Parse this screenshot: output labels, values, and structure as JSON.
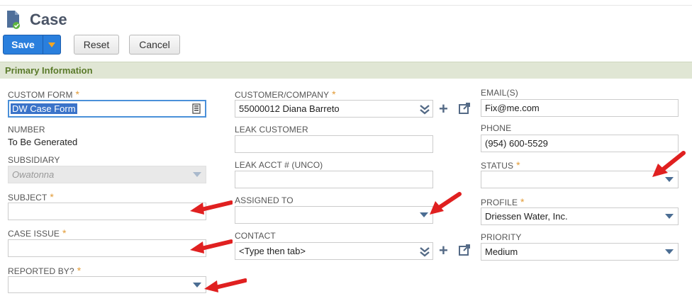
{
  "page": {
    "title": "Case"
  },
  "toolbar": {
    "save_label": "Save",
    "reset_label": "Reset",
    "cancel_label": "Cancel"
  },
  "section": {
    "title": "Primary Information"
  },
  "fields": {
    "custom_form": {
      "label": "CUSTOM FORM",
      "required": "*",
      "value": "DW Case Form"
    },
    "number": {
      "label": "NUMBER",
      "value": "To Be Generated"
    },
    "subsidiary": {
      "label": "SUBSIDIARY",
      "value": "Owatonna"
    },
    "subject": {
      "label": "SUBJECT",
      "required": "*",
      "value": ""
    },
    "case_issue": {
      "label": "CASE ISSUE",
      "required": "*",
      "value": ""
    },
    "reported_by": {
      "label": "REPORTED BY?",
      "required": "*",
      "value": ""
    },
    "customer_company": {
      "label": "CUSTOMER/COMPANY",
      "required": "*",
      "value": "55000012 Diana Barreto"
    },
    "leak_customer": {
      "label": "LEAK CUSTOMER",
      "value": ""
    },
    "leak_acct": {
      "label": "LEAK ACCT # (UNCO)",
      "value": ""
    },
    "assigned_to": {
      "label": "ASSIGNED TO",
      "value": ""
    },
    "contact": {
      "label": "CONTACT",
      "value": "<Type then tab>"
    },
    "email": {
      "label": "EMAIL(S)",
      "value": "Fix@me.com"
    },
    "phone": {
      "label": "PHONE",
      "value": "(954) 600-5529"
    },
    "status": {
      "label": "STATUS",
      "required": "*",
      "value": ""
    },
    "profile": {
      "label": "PROFILE",
      "required": "*",
      "value": "Driessen Water, Inc."
    },
    "priority": {
      "label": "PRIORITY",
      "value": "Medium"
    }
  },
  "icons": {
    "page": "case-document-icon",
    "save_dropdown": "caret-down-icon",
    "custom_form_list": "list-icon",
    "dropdown": "caret-down-icon",
    "multi_select": "double-chevron-down-icon",
    "add": "plus-icon",
    "open": "open-external-icon",
    "annotation": "red-arrow-icon"
  },
  "colors": {
    "accent": "#2a7fdd",
    "section_bg": "#e0e6d4",
    "section_text": "#5a7a2a",
    "required": "#e29b36",
    "annotation": "#e02020"
  }
}
